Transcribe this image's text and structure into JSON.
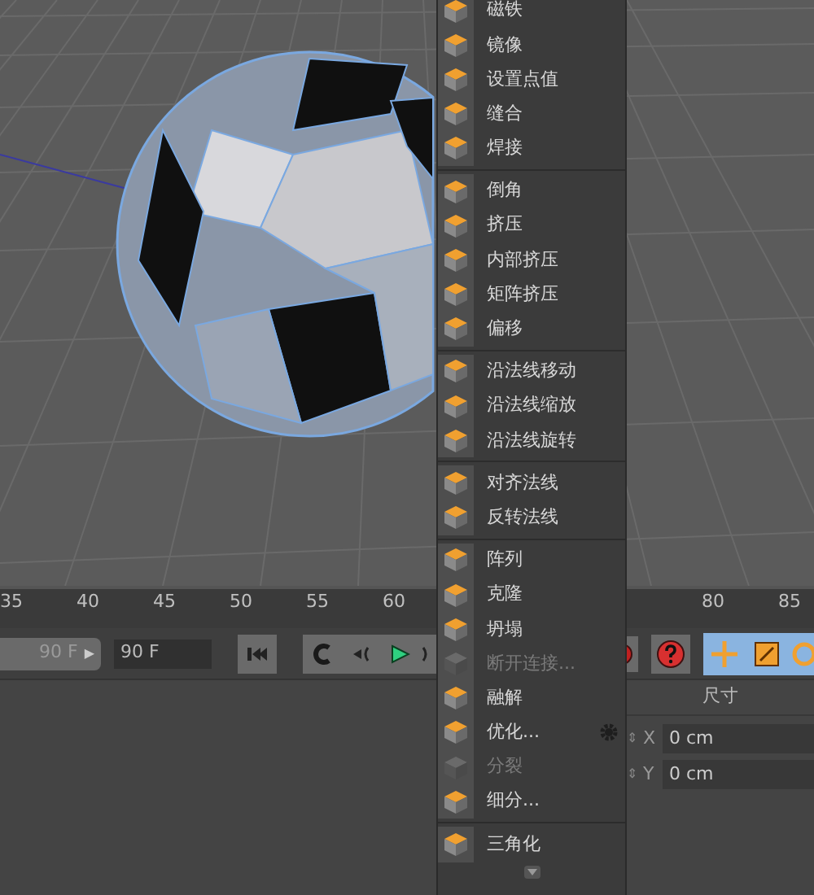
{
  "ruler": {
    "left_labels": [
      "35",
      "40",
      "45",
      "50",
      "55",
      "60"
    ],
    "right_labels": [
      "80",
      "85"
    ]
  },
  "transport": {
    "end_field": "90 F",
    "end_arrow": "▶",
    "current_field": "90 F"
  },
  "attributes": {
    "header": "尺寸",
    "rows": [
      {
        "spinner": "⇕",
        "axis": "X",
        "value": "0 cm"
      },
      {
        "spinner": "⇕",
        "axis": "Y",
        "value": "0 cm"
      }
    ]
  },
  "menu": {
    "groups": [
      [
        {
          "label": "磁铁",
          "disabled": false
        },
        {
          "label": "镜像",
          "disabled": false
        },
        {
          "label": "设置点值",
          "disabled": false
        },
        {
          "label": "缝合",
          "disabled": false
        },
        {
          "label": "焊接",
          "disabled": false
        }
      ],
      [
        {
          "label": "倒角",
          "disabled": false
        },
        {
          "label": "挤压",
          "disabled": false
        },
        {
          "label": "内部挤压",
          "disabled": false
        },
        {
          "label": "矩阵挤压",
          "disabled": false
        },
        {
          "label": "偏移",
          "disabled": false
        }
      ],
      [
        {
          "label": "沿法线移动",
          "disabled": false
        },
        {
          "label": "沿法线缩放",
          "disabled": false
        },
        {
          "label": "沿法线旋转",
          "disabled": false
        }
      ],
      [
        {
          "label": "对齐法线",
          "disabled": false
        },
        {
          "label": "反转法线",
          "disabled": false
        }
      ],
      [
        {
          "label": "阵列",
          "disabled": false
        },
        {
          "label": "克隆",
          "disabled": false
        },
        {
          "label": "坍塌",
          "disabled": false
        },
        {
          "label": "断开连接...",
          "disabled": true
        },
        {
          "label": "融解",
          "disabled": false
        },
        {
          "label": "优化...",
          "disabled": false,
          "options": true
        },
        {
          "label": "分裂",
          "disabled": true
        },
        {
          "label": "细分...",
          "disabled": false
        }
      ],
      [
        {
          "label": "三角化",
          "disabled": false
        }
      ]
    ]
  }
}
